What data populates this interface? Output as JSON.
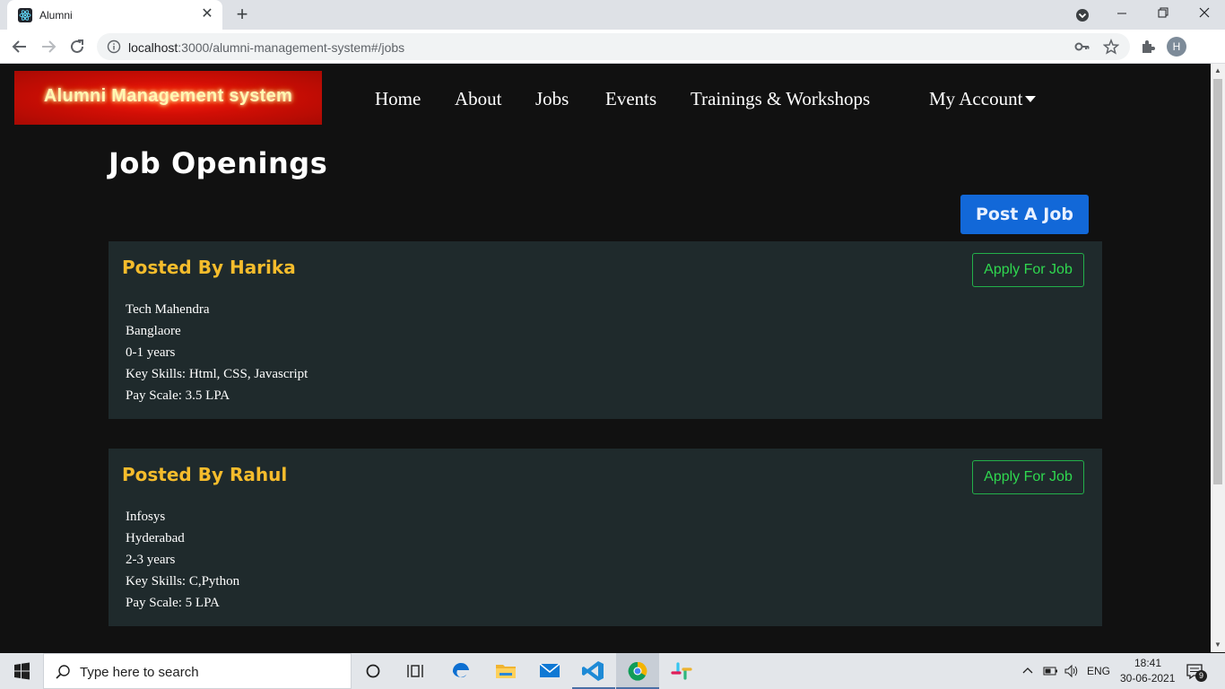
{
  "browser": {
    "tab_title": "Alumni",
    "url_host": "localhost",
    "url_rest": ":3000/alumni-management-system#/jobs",
    "profile_initial": "H"
  },
  "navbar": {
    "brand": "Alumni Management system",
    "items": [
      {
        "label": "Home"
      },
      {
        "label": "About"
      },
      {
        "label": "Jobs"
      },
      {
        "label": "Events"
      },
      {
        "label": "Trainings & Workshops"
      }
    ],
    "account_label": "My Account"
  },
  "main": {
    "title": "Job Openings",
    "post_button": "Post A Job",
    "jobs": [
      {
        "posted_by": "Posted By Harika",
        "apply_label": "Apply For Job",
        "company": "Tech Mahendra",
        "location": "Banglaore",
        "experience": "0-1 years",
        "skills": "Key Skills: Html, CSS, Javascript",
        "pay": "Pay Scale: 3.5 LPA"
      },
      {
        "posted_by": "Posted By Rahul",
        "apply_label": "Apply For Job",
        "company": "Infosys",
        "location": "Hyderabad",
        "experience": "2-3 years",
        "skills": "Key Skills: C,Python",
        "pay": "Pay Scale: 5 LPA"
      }
    ]
  },
  "taskbar": {
    "search_placeholder": "Type here to search",
    "language": "ENG",
    "time": "18:41",
    "date": "30-06-2021",
    "notification_count": "9"
  },
  "colors": {
    "page_bg": "#111111",
    "card_bg": "#1f2a2c",
    "card_title": "#f5bc2c",
    "apply_green": "#2fd84f",
    "post_blue": "#1268d8",
    "logo_red": "#d10e05"
  },
  "icons": [
    "react-favicon-icon",
    "close-icon",
    "plus-icon",
    "tab-search-icon",
    "minimize-icon",
    "restore-icon",
    "window-close-icon",
    "back-icon",
    "forward-icon",
    "reload-icon",
    "info-icon",
    "key-icon",
    "star-icon",
    "extensions-icon",
    "windows-start-icon",
    "search-icon",
    "cortana-icon",
    "task-view-icon",
    "edge-icon",
    "file-explorer-icon",
    "mail-icon",
    "vscode-icon",
    "chrome-icon",
    "slack-icon",
    "chevron-up-icon",
    "battery-icon",
    "volume-icon",
    "notification-icon"
  ]
}
